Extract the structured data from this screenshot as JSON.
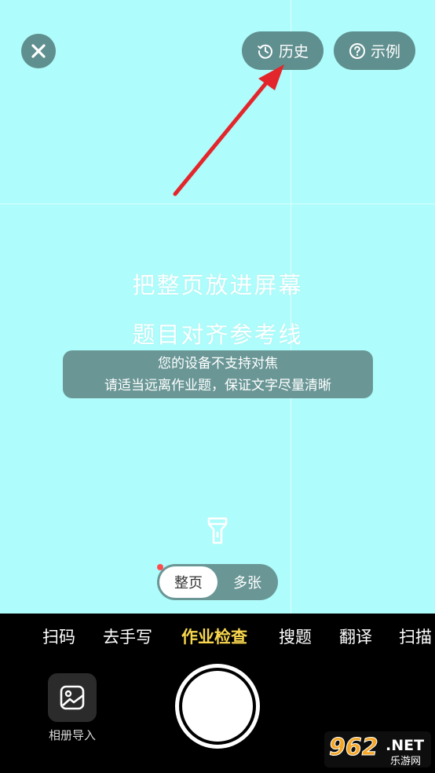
{
  "header": {
    "history_label": "历史",
    "example_label": "示例"
  },
  "guide": {
    "line1": "把整页放进屏幕",
    "line2": "题目对齐参考线"
  },
  "warning": {
    "line1": "您的设备不支持对焦",
    "line2": "请适当远离作业题，保证文字尽量清晰"
  },
  "mode_toggle": {
    "active": "整页",
    "other": "多张"
  },
  "tabs": [
    {
      "label": "扫码"
    },
    {
      "label": "去手写"
    },
    {
      "label": "作业检查"
    },
    {
      "label": "搜题"
    },
    {
      "label": "翻译"
    },
    {
      "label": "扫描"
    }
  ],
  "album": {
    "label": "相册导入"
  },
  "watermark": {
    "number": "962",
    "suffix": ".NET",
    "sub": "乐游网"
  },
  "colors": {
    "viewfinder": "#aefcfb",
    "pill": "#5f8f8e",
    "active_tab": "#f8d64e",
    "arrow": "#e3262b",
    "badge_dot": "#ff4d4f"
  }
}
